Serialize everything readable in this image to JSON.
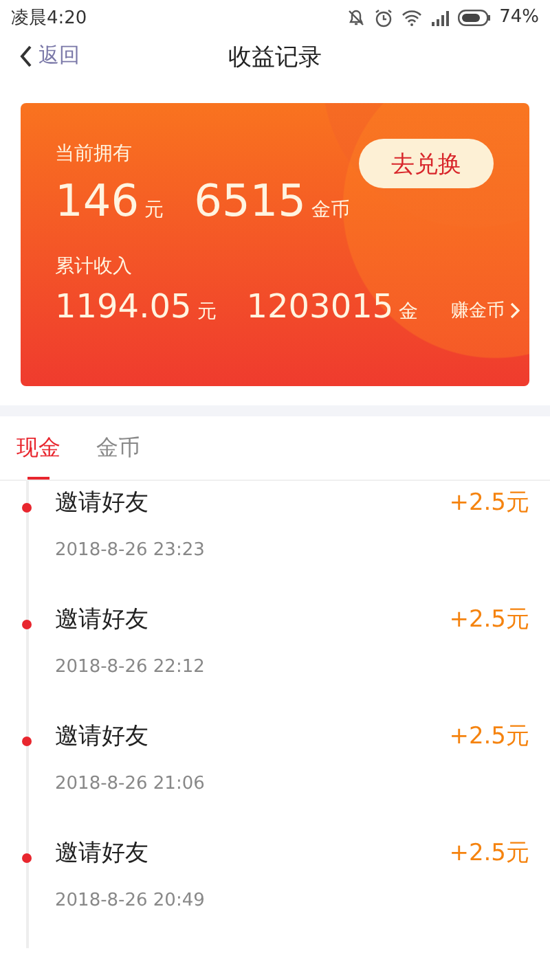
{
  "status_bar": {
    "time": "凌晨4:20",
    "battery": "74%"
  },
  "header": {
    "back": "返回",
    "title": "收益记录"
  },
  "card": {
    "current_label": "当前拥有",
    "cash": "146",
    "cash_unit": "元",
    "coins": "6515",
    "coins_unit": "金币",
    "exchange_button": "去兑换",
    "total_label": "累计收入",
    "total_cash": "1194.05",
    "total_cash_unit": "元",
    "total_coins": "1203015",
    "total_coins_unit": "金",
    "earn_link": "赚金币"
  },
  "tabs": [
    {
      "label": "现金",
      "selected": true
    },
    {
      "label": "金币",
      "selected": false
    }
  ],
  "records": [
    {
      "title": "邀请好友",
      "time": "2018-8-26 23:23",
      "amount": "+2.5元"
    },
    {
      "title": "邀请好友",
      "time": "2018-8-26 22:12",
      "amount": "+2.5元"
    },
    {
      "title": "邀请好友",
      "time": "2018-8-26 21:06",
      "amount": "+2.5元"
    },
    {
      "title": "邀请好友",
      "time": "2018-8-26 20:49",
      "amount": "+2.5元"
    }
  ]
}
